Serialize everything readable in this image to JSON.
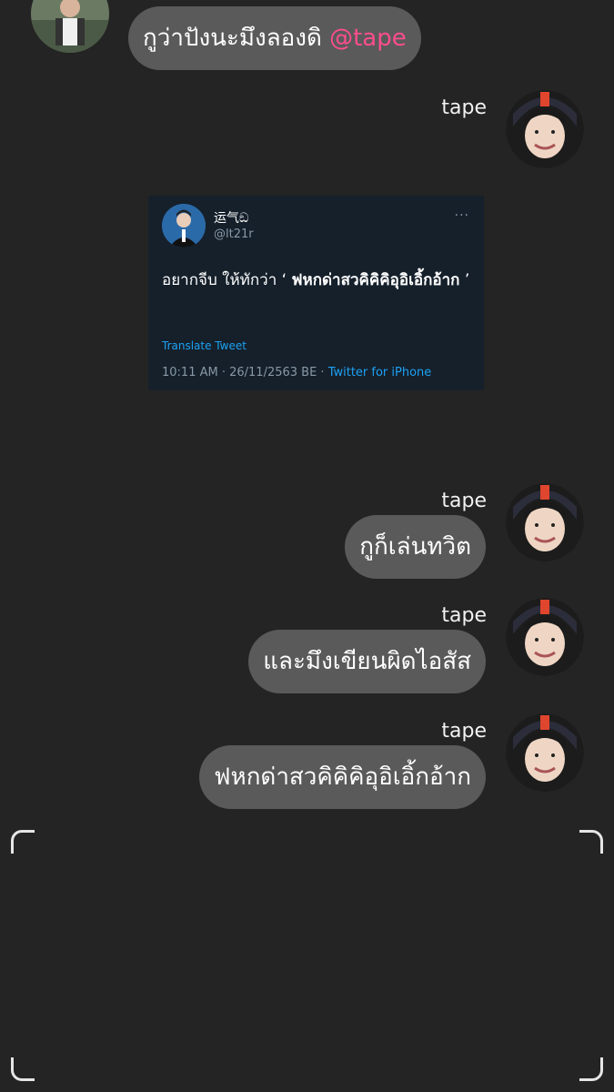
{
  "top_message": {
    "text": "กูว่าปังนะมึงลองดิ",
    "mention": "@tape"
  },
  "sender_name": "tape",
  "tweet": {
    "display_name": "运气ඞ",
    "handle": "@lt21r",
    "more": "···",
    "body_prefix": "อยากจีบ ให้ทักว่า ‘ ",
    "body_bold": "ฟหกด่าสวคิคิคิอุอิเอิ้กอ้าก",
    "body_suffix": " ’",
    "translate": "Translate Tweet",
    "meta_time": "10:11 AM · 26/11/2563 BE · ",
    "meta_source": "Twitter for iPhone"
  },
  "messages": [
    {
      "name": "tape",
      "text": "กูก็เล่นทวิต"
    },
    {
      "name": "tape",
      "text": "และมึงเขียนผิดไอสัส"
    },
    {
      "name": "tape",
      "text": "ฟหกด่าสวคิคิคิอุอิเอิ้กอ้าก"
    }
  ],
  "colors": {
    "background": "#242424",
    "bubble": "#5a5a5a",
    "mention": "#ff4d8d",
    "tweet_bg": "#15202b",
    "link": "#1da1f2"
  }
}
